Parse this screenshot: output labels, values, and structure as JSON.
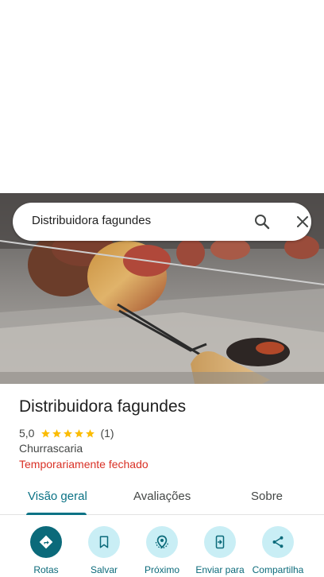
{
  "search": {
    "query": "Distribuidora fagundes"
  },
  "place": {
    "title": "Distribuidora fagundes",
    "rating": "5,0",
    "review_count": "(1)",
    "stars": 5,
    "category": "Churrascaria",
    "status": "Temporariamente fechado"
  },
  "tabs": [
    {
      "label": "Visão geral",
      "active": true
    },
    {
      "label": "Avaliações",
      "active": false
    },
    {
      "label": "Sobre",
      "active": false
    }
  ],
  "actions": [
    {
      "label": "Rotas",
      "icon": "directions-icon"
    },
    {
      "label": "Salvar",
      "icon": "bookmark-icon"
    },
    {
      "label": "Próximo",
      "icon": "nearby-icon"
    },
    {
      "label": "Enviar para",
      "icon": "send-to-phone-icon"
    },
    {
      "label": "Compartilha",
      "icon": "share-icon"
    }
  ],
  "colors": {
    "accent": "#0b7285",
    "action_bg": "#c9eef5",
    "primary_action": "#0b6a7a",
    "closed_status": "#d93025",
    "star": "#fbbc04"
  }
}
